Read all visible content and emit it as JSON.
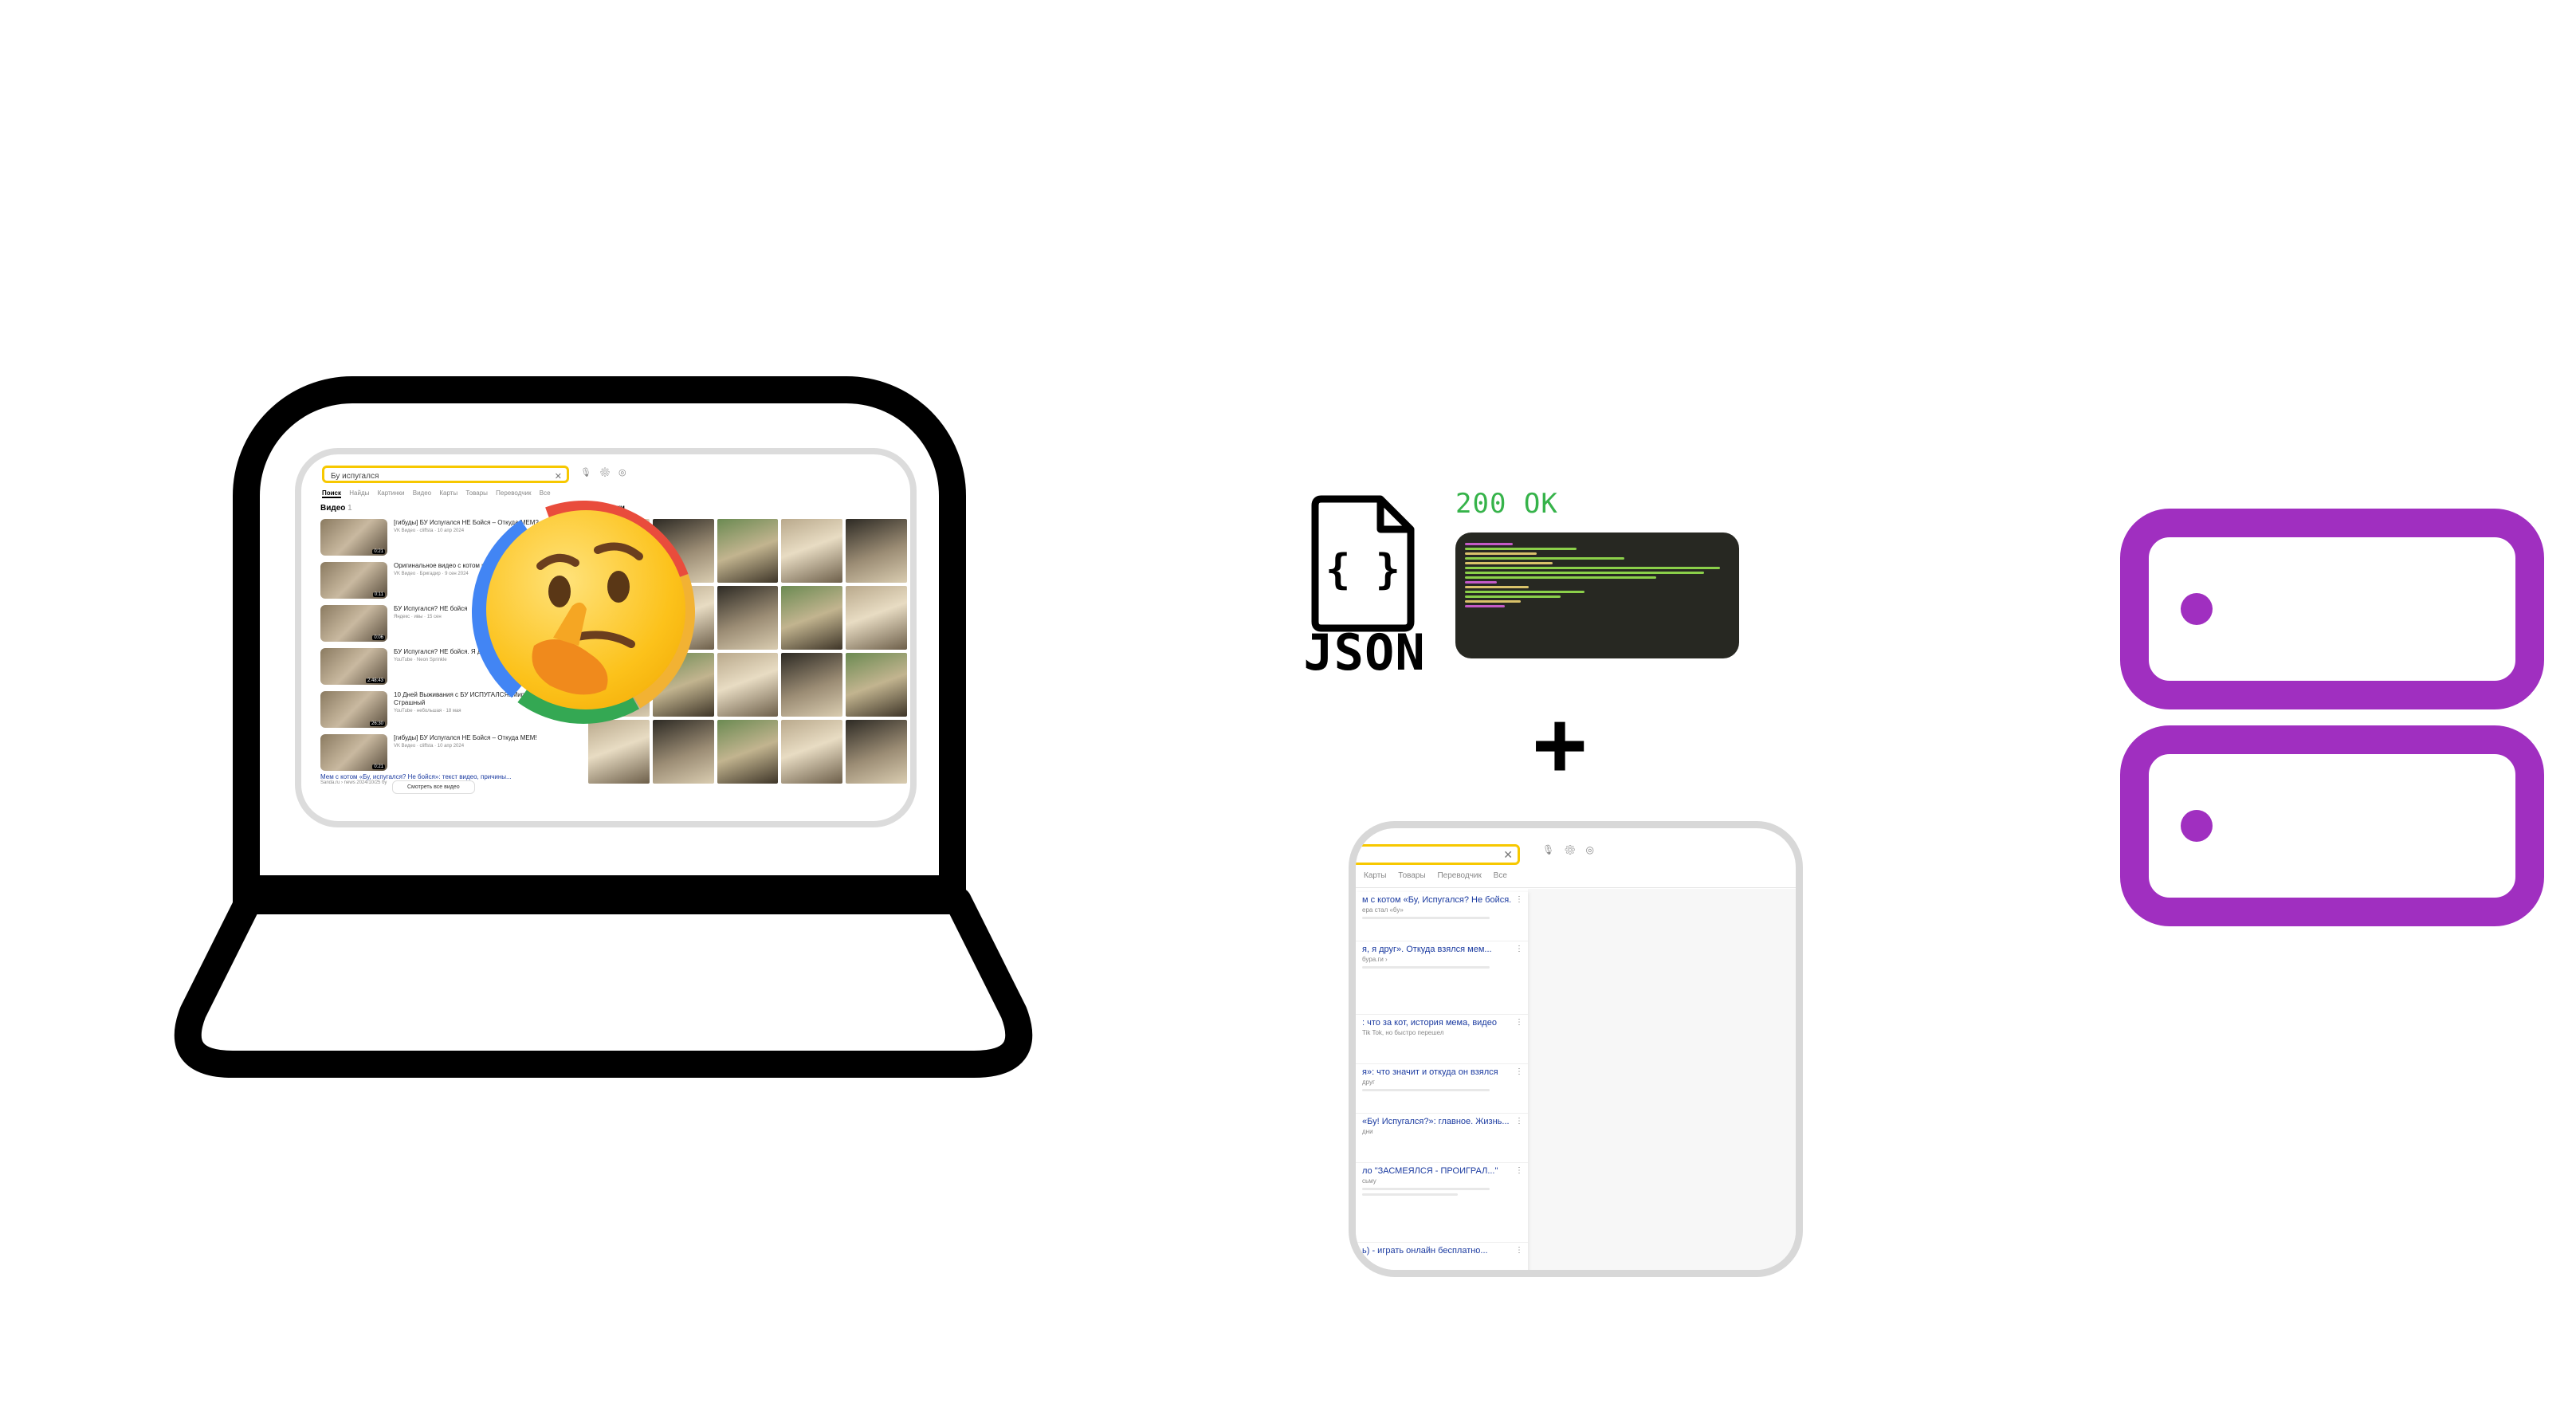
{
  "screen": {
    "search_query": "Бу испугался",
    "tabs": [
      "Поиск",
      "Найды",
      "Картинки",
      "Видео",
      "Карты",
      "Товары",
      "Переводчик",
      "Все"
    ],
    "videos_title": "Видео",
    "videos_count": "1",
    "videos": [
      {
        "title": "[гибуды] БУ Испугался НЕ Бойся – Откуда МЕМ?",
        "meta": "VK Видео · cliffsta · 10 апр 2024",
        "duration": "0:21"
      },
      {
        "title": "Оригинальное видео с котом и «бу испугался»",
        "meta": "VK Видео · Бригадир · 9 сен 2024",
        "duration": "0:11"
      },
      {
        "title": "БУ Испугался? НЕ бойся",
        "meta": "Яндекс · ивы · 15 сен",
        "duration": "0:06"
      },
      {
        "title": "БУ Испугался? НЕ бойся. Я друг... Стрим",
        "meta": "YouTube · Neon Sprinkle",
        "duration": "2:48:43"
      },
      {
        "title": "10 Дней Выживания с БУ ИСПУГАЛСЯ. Мира майнкрафт | Страшный",
        "meta": "YouTube · небольшая · 18 мая",
        "duration": "26:30"
      },
      {
        "title": "[гибуды] БУ Испугался НЕ Бойся – Откуда МЕМ!",
        "meta": "VK Видео · cliffsta · 10 апр 2024",
        "duration": "0:21"
      }
    ],
    "all_videos_label": "Смотреть все видео",
    "images_title": "Картинки",
    "text_result_title": "Мем с котом «Бу, испугался? Не бойся»: текст видео, причины...",
    "text_result_meta": "Sanda.ru › news 2024/10/25 бу"
  },
  "json_label": "JSON",
  "status_text": "200 OK",
  "plus": "+",
  "partial": {
    "tabs": [
      "Карты",
      "Товары",
      "Переводчик",
      "Все"
    ],
    "items": [
      {
        "title": "м с котом «Бу, Испугался? Не бойся.",
        "sub": "ера стал «бу»"
      },
      {
        "title": "я, я друг». Откуда взялся мем...",
        "sub": "бура.ги ›"
      },
      {
        "title": ": что за кот, история мема, видео",
        "sub": "Tik Tok, но быстро перешел"
      },
      {
        "title": "я»: что значит и откуда он взялся",
        "sub": "друг"
      },
      {
        "title": "«Бу! Испугался?»: главное. Жизнь...",
        "sub": "дни"
      },
      {
        "title": "ло \"ЗАСМЕЯЛСЯ - ПРОИГРАЛ...\"",
        "sub": "сьму"
      },
      {
        "title": "ь) - играть онлайн бесплатно...",
        "sub": ""
      }
    ]
  },
  "colors": {
    "server": "#a02fc0",
    "status_ok": "#36b34a",
    "code_bg": "#272822",
    "search_border": "#f7c800"
  },
  "icons": [
    "thinking-face-icon",
    "loading-ring-icon",
    "json-file-icon",
    "server-icon"
  ]
}
